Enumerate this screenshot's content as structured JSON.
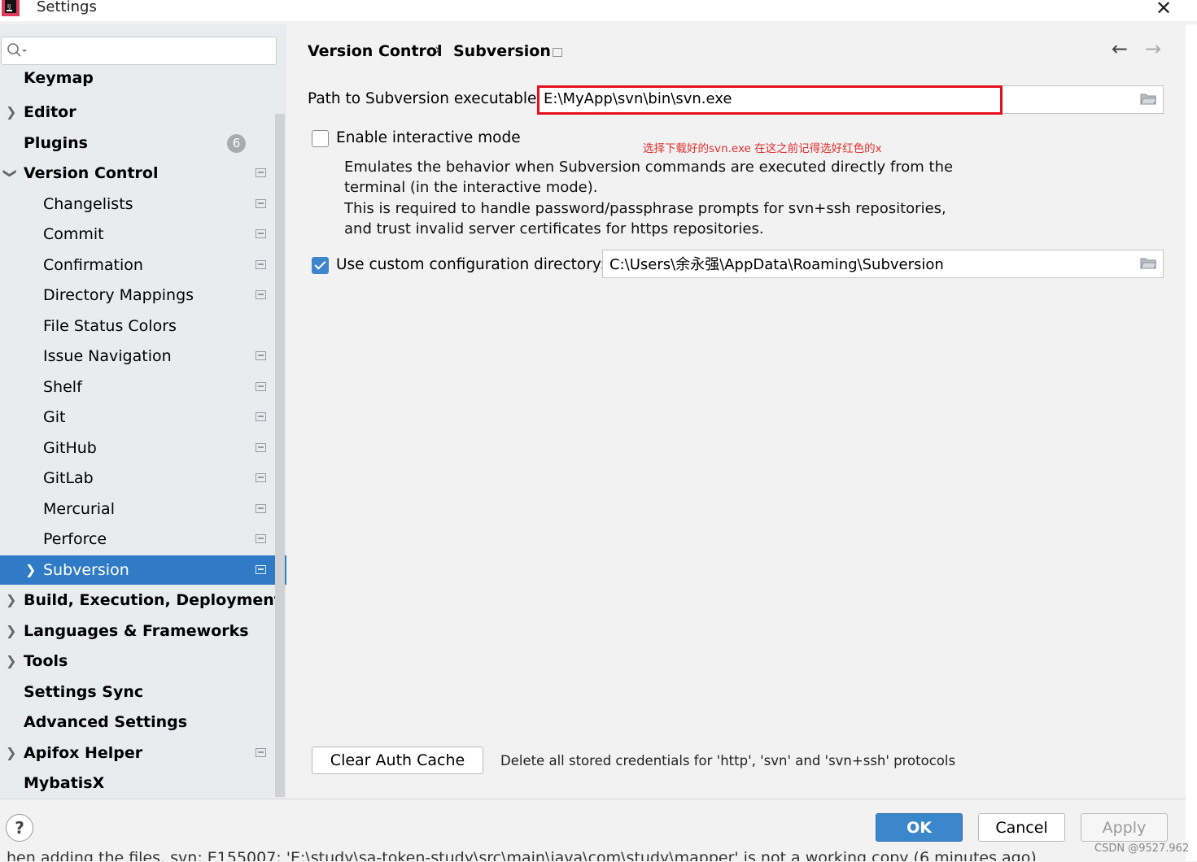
{
  "window": {
    "title": "Settings",
    "close_glyph": "✕"
  },
  "search": {
    "placeholder": "",
    "value": ""
  },
  "sidebar": {
    "items": [
      {
        "label": "Keymap"
      },
      {
        "label": "Editor"
      },
      {
        "label": "Plugins",
        "badge": "6"
      },
      {
        "label": "Version Control"
      },
      {
        "label": "Changelists"
      },
      {
        "label": "Commit"
      },
      {
        "label": "Confirmation"
      },
      {
        "label": "Directory Mappings"
      },
      {
        "label": "File Status Colors"
      },
      {
        "label": "Issue Navigation"
      },
      {
        "label": "Shelf"
      },
      {
        "label": "Git"
      },
      {
        "label": "GitHub"
      },
      {
        "label": "GitLab"
      },
      {
        "label": "Mercurial"
      },
      {
        "label": "Perforce"
      },
      {
        "label": "Subversion",
        "selected": true
      },
      {
        "label": "Build, Execution, Deployment"
      },
      {
        "label": "Languages & Frameworks"
      },
      {
        "label": "Tools"
      },
      {
        "label": "Settings Sync"
      },
      {
        "label": "Advanced Settings"
      },
      {
        "label": "Apifox Helper"
      },
      {
        "label": "MybatisX"
      }
    ]
  },
  "breadcrumb": {
    "parent": "Version Control",
    "separator": "›",
    "current": "Subversion"
  },
  "nav": {
    "back": "←",
    "forward": "→"
  },
  "subversion": {
    "path_label": "Path to Subversion executable:",
    "path_value": "E:\\MyApp\\svn\\bin\\svn.exe",
    "interactive_label": "Enable interactive mode",
    "interactive_checked": false,
    "annotation": "选择下载好的svn.exe 在这之前记得选好红色的x",
    "desc_line1": "Emulates the behavior when Subversion commands are executed directly from the",
    "desc_line2": "terminal (in the interactive mode).",
    "desc_line3": "This is required to handle password/passphrase prompts for svn+ssh repositories,",
    "desc_line4": "and trust invalid server certificates for https repositories.",
    "custom_dir_label": "Use custom configuration directory:",
    "custom_dir_checked": true,
    "custom_dir_value": "C:\\Users\\余永强\\AppData\\Roaming\\Subversion",
    "clear_cache_label": "Clear Auth Cache",
    "clear_cache_desc": "Delete all stored credentials for 'http', 'svn' and 'svn+ssh' protocols"
  },
  "footer": {
    "help": "?",
    "ok": "OK",
    "cancel": "Cancel",
    "apply": "Apply",
    "underlying_text": "hen adding the files. svn: E155007: 'E:\\study\\sa-token-study\\src\\main\\java\\com\\study\\mapper' is not a working copy (6 minutes ago)",
    "watermark": "CSDN @9527.962"
  },
  "colors": {
    "selection": "#2f7bc5",
    "highlight_box": "#e5101d",
    "annotation": "#e53030",
    "primary_button": "#3b87cc"
  }
}
